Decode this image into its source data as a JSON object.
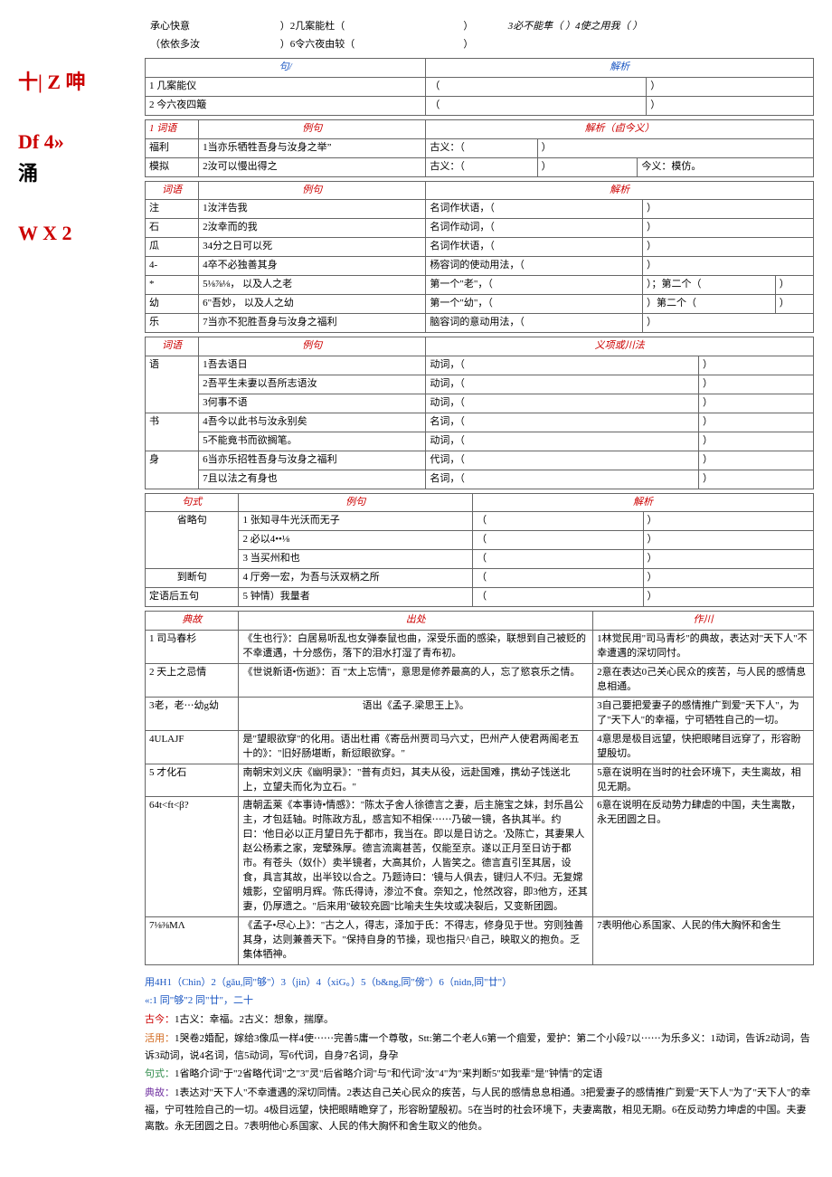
{
  "sidebar": {
    "s1": "十|\nZ 呻",
    "s2": "Df\n4»",
    "s3": "涌",
    "s4": "W\nX\n2"
  },
  "toprow": {
    "t1": "承心快意",
    "t2": "）2几案能杜（",
    "t3": "）",
    "t4": "3必不能隼（     ）4使之用我（       ）",
    "t5": "（依依多汝",
    "t6": "）6令六夜由较（",
    "t7": "）"
  },
  "tbl1": {
    "h1": "句/",
    "h2": "解析",
    "r1c1": "1 几案能仪",
    "r1c2": "（",
    "r1c3": "）",
    "r2c1": "2 今六夜四簸",
    "r2c2": "（",
    "r2c3": "）"
  },
  "tbl2": {
    "h1": "1 词语",
    "h2": "例句",
    "h3": "解析（卣今义）",
    "r1c1": "福利",
    "r1c2": "1当亦乐牺牲吾身与汝身之举”",
    "r1c3": "古义：（",
    "r1c4": "）",
    "r2c1": "模拟",
    "r2c2": "2汝可以慢出得之",
    "r2c3": "古义：（",
    "r2c4": "）",
    "r2c5": "今义：模仿。"
  },
  "tbl3": {
    "h1": "词语",
    "h2": "例句",
    "h3": "解析",
    "r1c1": "注",
    "r1c2": "1汝泮告我",
    "r1c3": "名词作状语，（",
    "r1c4": "）",
    "r2c1": "石",
    "r2c2": "2汝幸而的我",
    "r2c3": "名词作动词，（",
    "r2c4": "）",
    "r3c1": "瓜",
    "r3c2": "34分之日可以死",
    "r3c3": "名词作状语，（",
    "r3c4": "）",
    "r4c1": "4-",
    "r4c2": "4卒不必独善其身",
    "r4c3": "杨容词的使动用法，（",
    "r4c4": "）",
    "r5c1": "*",
    "r5c2": "5⅛⅞⅛，    以及人之老",
    "r5c3": "第一个\"老\"，（",
    "r5c4": "）；第二个（",
    "r5c5": "）",
    "r6c1": "幼",
    "r6c2": "6\"吾妙，    以及人之幼",
    "r6c3": "第一个\"幼\"，（",
    "r6c4": "）第二个（",
    "r6c5": "）",
    "r7c1": "乐",
    "r7c2": "7当亦不犯胜吾身与汝身之福利",
    "r7c3": "脑容词的意动用法，（",
    "r7c4": "）"
  },
  "tbl4": {
    "h1": "词语",
    "h2": "例句",
    "h3": "义项或川法",
    "r1c1": "语",
    "r1c2": "1吾去语日",
    "r1c3": "动词，（",
    "r1c4": "）",
    "r2c2": "2吾平生未妻以吾所志语汝",
    "r2c3": "动词，（",
    "r2c4": "）",
    "r3c2": "3何事不语",
    "r3c3": "动词，（",
    "r3c4": "）",
    "r4c1": "书",
    "r4c2": "4吾今以此书与汝永别矣",
    "r4c3": "名词，（",
    "r4c4": "）",
    "r5c2": "5不能竟书而欲搁笔。",
    "r5c3": "动词，（",
    "r5c4": "）",
    "r6c1": "身",
    "r6c2": "6当亦乐招牲吾身与汝身之福利",
    "r6c3": "代词，（",
    "r6c4": "）",
    "r7c2": "7且以法之有身也",
    "r7c3": "名词，（",
    "r7c4": "）"
  },
  "tbl5": {
    "h1": "句式",
    "h2": "例句",
    "h3": "解析",
    "r1c1": "省略句",
    "r1c2": "1 张知寻牛光沃而无子",
    "r1c3": "（",
    "r1c4": "）",
    "r2c2": "2 必以4••⅛",
    "r2c3": "（",
    "r2c4": "）",
    "r3c2": "3 当买州和也",
    "r3c3": "（",
    "r3c4": "）",
    "r4c1": "到断句",
    "r4c2": "4 厅旁一宏，为吾与沃双柄之所",
    "r4c3": "（",
    "r4c4": "）",
    "r5c1": "定语后五句",
    "r5c2": "5 钟情）我量者",
    "r5c3": "（",
    "r5c4": "）"
  },
  "tbl6": {
    "h1": "典故",
    "h2": "出处",
    "h3": "作川",
    "r1c1": "1 司马春杉",
    "r1c2": "《生也行》：白居易听乱也女弹泰鼠也曲，深受乐面的感染，联想到自己被贬的不幸遭遇，十分感伤，落下的泪水打湿了青布初。",
    "r1c3": "1林觉民用\"司马青杉\"的典故，表达对\"天下人\"不幸遭遇的深切同忖。",
    "r2c1": "2 天上之忌情",
    "r2c2": "《世说新语•伤逝》：百 \"太上忘情\"，意思是修养最高的人，忘了慾哀乐之情。",
    "r2c3": "2意在表达0己关心民众的疾苦，与人民的感情息息相通。",
    "r3c1": "3老，老⋯幼g幼",
    "r3c2": "语出《孟子.梁思王上》。",
    "r3c3": "3自己要把爱妻子的感情推广到爱\"天下人\"，为了\"天下人\"的幸福，宁可牺牲自己的一切。",
    "r4c1": "4ULAJF",
    "r4c2": "是\"望眼欲穿\"的化用。语出杜甫《寄岳州贾司马六丈，巴州产人使君两阁老五十的》：\"旧好肠堪断，新愆眼欲穿。\"",
    "r4c3": "4意思是极目远望，快把眼睹目远穿了，形容盼望殷切。",
    "r5c1": "5 才化石",
    "r5c2": "南朝宋刘义庆《幽明录》：\"普有贞妇，其夫从役，远赴国难，携幼子饯送北上，立望夫而化为立石。\"",
    "r5c3": "5意在说明在当时的社会环境下，夫生离故，相见无期。",
    "r6c1": "64t<ft<β?",
    "r6c2": "唐朝盂莱《本事诗•情感》：\"陈太子舍人徐德言之妻，后主施宝之妹，封乐昌公主，才包廷轴。时陈政方乱，感言知不相保⋯⋯乃破一镜，各执其半。约曰：'他日必以正月望日先于都市，我当在。即以是日访之。'及陈亡，其妻果人赵公杨素之家，宠擘殊厚。德言流离甚苦，仅能至京。遂以正月至日访于都市。有苍头（奴仆）卖半镜者，大高其价，人皆笑之。德言直引至其居，设食，具言其故，出半铰以合之。乃题诗曰：'镜与人俱去，键归人不归。无复嫦娥影，空留明月辉。'陈氏得诗，渗泣不食。奈知之，怆然改容，即3他方，还其妻，仍厚遗之。\"后来用\"破较充圆\"比喻夫生失坟或决裂后，又变新团圆。",
    "r6c3": "6意在说明在反动势力肆虐的中国，夫生离散，永无团圆之日。",
    "r7c1": "7⅛⅜MΛ",
    "r7c2": "《孟子•尽心上》：\"古之人，得志，泽加于氏：不得志，修身见于世。穷则独善其身，达则兼善天下。\"保持自身的节操，现也指只^自己，映取义的抱负。乏集体牺神。",
    "r7c3": "7表明他心系国家、人民的伟大胸怀和舍生"
  },
  "answers": {
    "a1": "用4H1（Chin）2（gǎu,同\"够\"）3（jin）4（xiG。）5（b&ng,同\"傍\"）6（nidn,同\"廿\"）",
    "a2": "«:1 同\"够\"2 同\"廿\"，二十",
    "a3label": "古今：",
    "a3": "1古义：幸福。2古义：想象，揣摩。",
    "a4label": "活用：",
    "a4": "1哭卷2婚配，嫁给3像瓜一样4使⋯⋯完善5庸一个尊敬，Stt:第二个老人6第一个痼爱，爱护：第二个小段7以⋯⋯为乐多义：1动词，告诉2动词，告诉3动词，说4名词，信5动词，写6代词，自身7名词，身孕",
    "a5label": "句式：",
    "a5": "1省略介词\"于\"2省略代词\"之\"3\"灵\"后省略介词\"与\"和代词\"汝\"4\"为\"来判断5\"如我辈\"是\"钟情\"的定语",
    "a6label": "典故：",
    "a6": "1表达对\"天下人\"不幸遭遇的深切同情。2表达自己关心民众的疾苦，与人民的感情息息相通。3把爱妻子的感情推广到爱\"天下人\"为了\"天下人\"的幸福，宁可牲险自己的一切。4极目远望，快把眼睛瞻穿了，形容盼望殷初。5在当时的社会环境下，夫妻离散，相见无期。6在反动势力坤虐的中国。夫妻离散。永无团圆之日。7表明他心系国家、人民的伟大胸怀和舍生取义的他负。"
  }
}
